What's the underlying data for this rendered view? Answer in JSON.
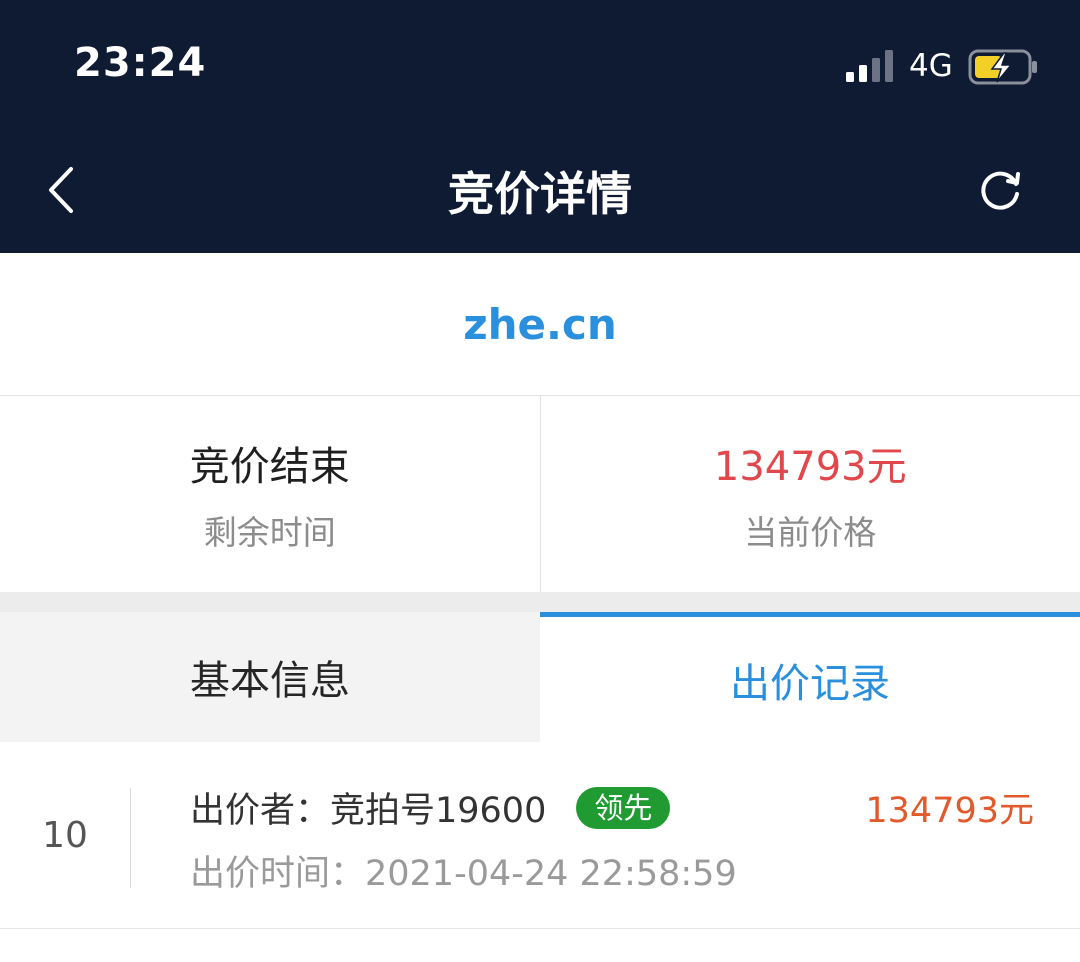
{
  "status_bar": {
    "time": "23:24",
    "network": "4G"
  },
  "nav": {
    "title": "竞价详情",
    "back_icon": "chevron-left-icon",
    "refresh_icon": "refresh-icon"
  },
  "domain": "zhe.cn",
  "stats": {
    "remaining_value": "竞价结束",
    "remaining_label": "剩余时间",
    "price_value": "134793元",
    "price_label": "当前价格"
  },
  "tabs": [
    {
      "label": "基本信息",
      "active": false
    },
    {
      "label": "出价记录",
      "active": true
    }
  ],
  "bids": [
    {
      "index": "10",
      "bidder": "出价者：竞拍号19600",
      "badge": "领先",
      "time": "出价时间：2021-04-24 22:58:59",
      "amount": "134793元"
    }
  ],
  "colors": {
    "header_bg": "#0f1a33",
    "accent_blue": "#2a8fdc",
    "price_red": "#e2474b",
    "bid_orange": "#e05a2c",
    "badge_green": "#1f9b32",
    "battery_yellow": "#f2d028"
  }
}
